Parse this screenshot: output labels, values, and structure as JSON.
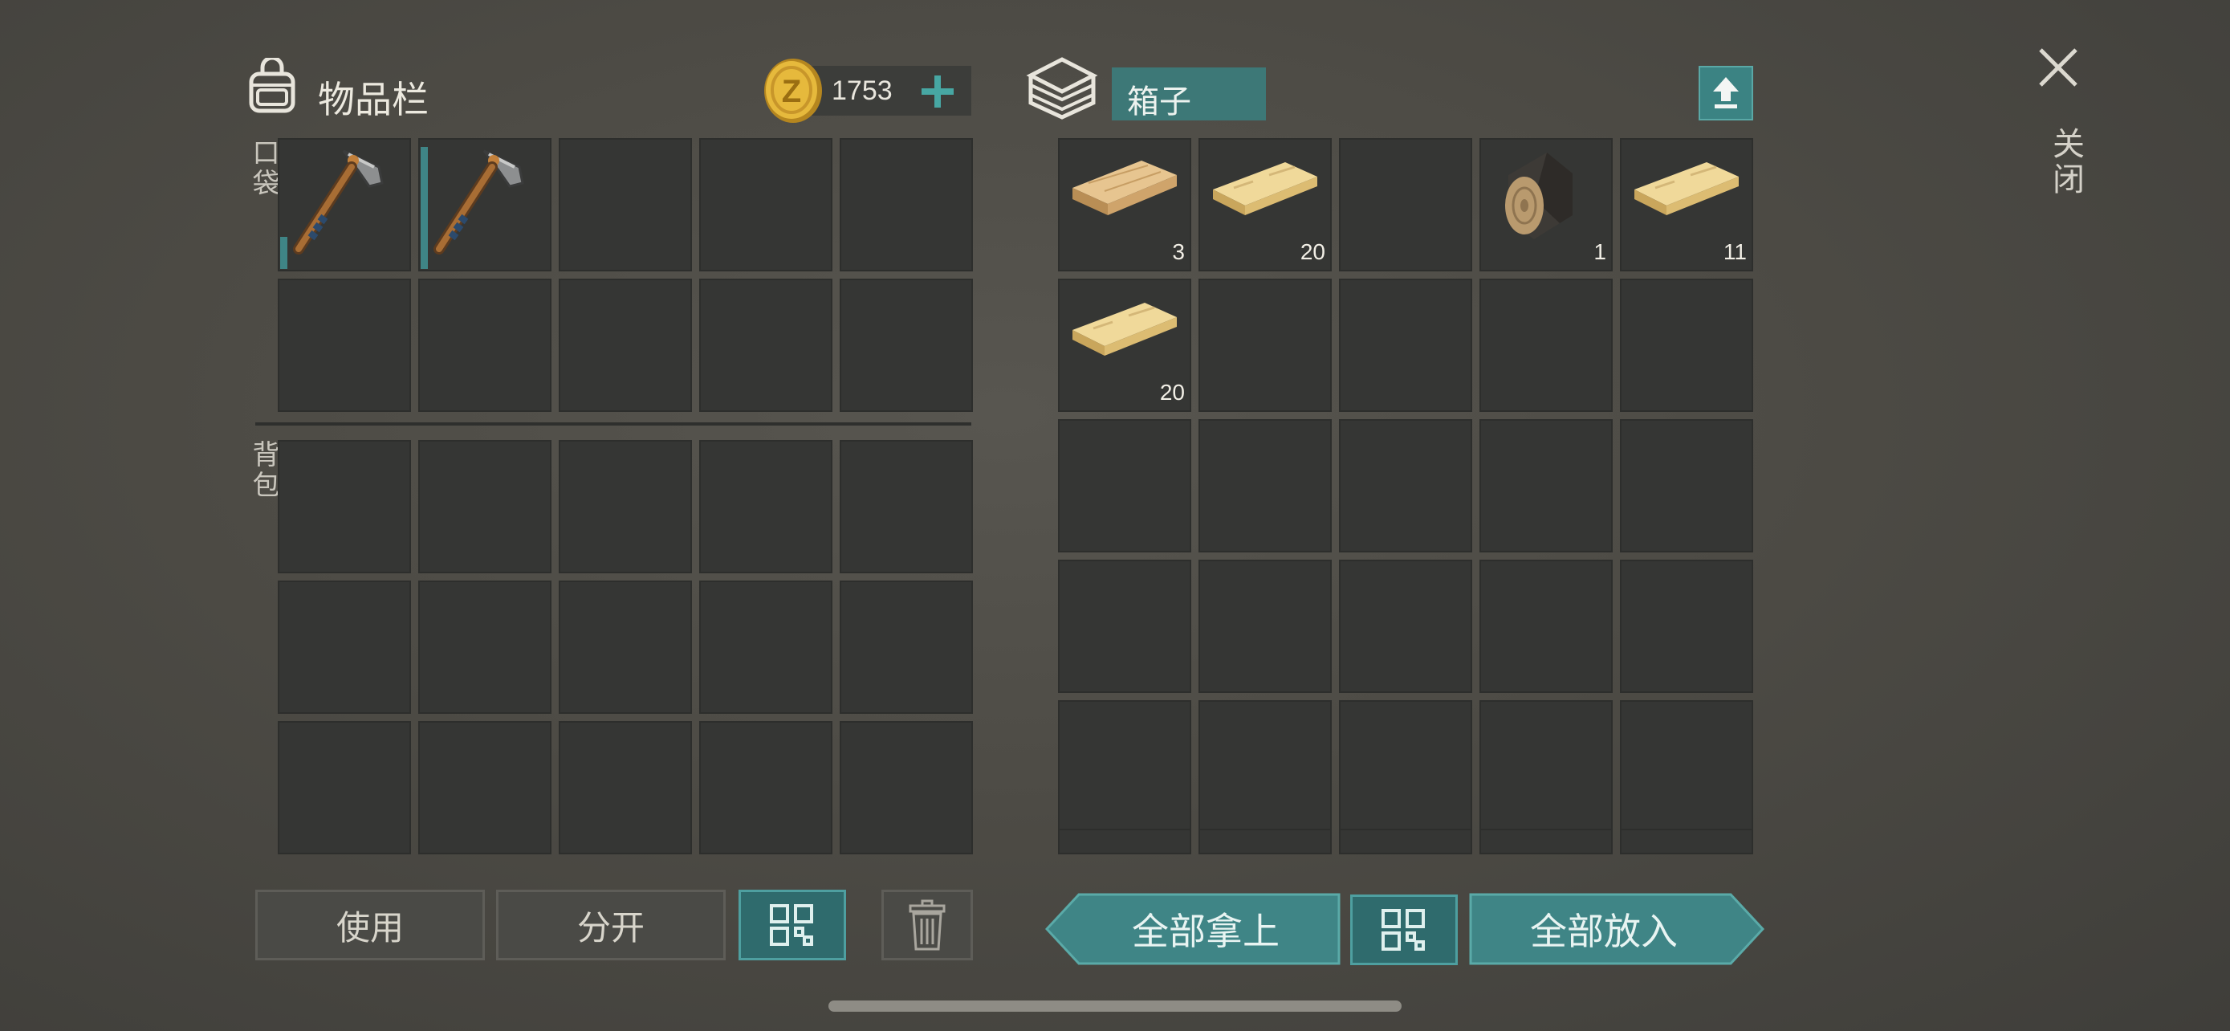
{
  "inventory": {
    "title": "物品栏",
    "coins": "1753",
    "pocket_label": "口袋",
    "backpack_label": "背包",
    "pocket_slots": [
      {
        "item": "pickaxe-icon",
        "durability": 0.25
      },
      {
        "item": "pickaxe-icon",
        "durability": 0.95
      },
      {},
      {},
      {},
      {},
      {},
      {},
      {},
      {}
    ],
    "backpack_slots": [
      {},
      {},
      {},
      {},
      {},
      {},
      {},
      {},
      {},
      {},
      {},
      {},
      {},
      {},
      {}
    ]
  },
  "box": {
    "title": "箱子",
    "slots": [
      {
        "item": "plank-icon",
        "count": "3"
      },
      {
        "item": "plank-light-icon",
        "count": "20"
      },
      {},
      {
        "item": "log-icon",
        "count": "1"
      },
      {
        "item": "plank-light-icon",
        "count": "11"
      },
      {
        "item": "plank-light-icon",
        "count": "20"
      },
      {},
      {},
      {},
      {},
      {},
      {},
      {},
      {},
      {},
      {},
      {},
      {},
      {},
      {},
      {},
      {},
      {},
      {},
      {}
    ]
  },
  "close_label": "关闭",
  "actions": {
    "use": "使用",
    "split": "分开",
    "take_all": "全部拿上",
    "put_all": "全部放入"
  },
  "colors": {
    "accent": "#3f8586",
    "slot": "#353634",
    "coin": "#e0b43a"
  }
}
